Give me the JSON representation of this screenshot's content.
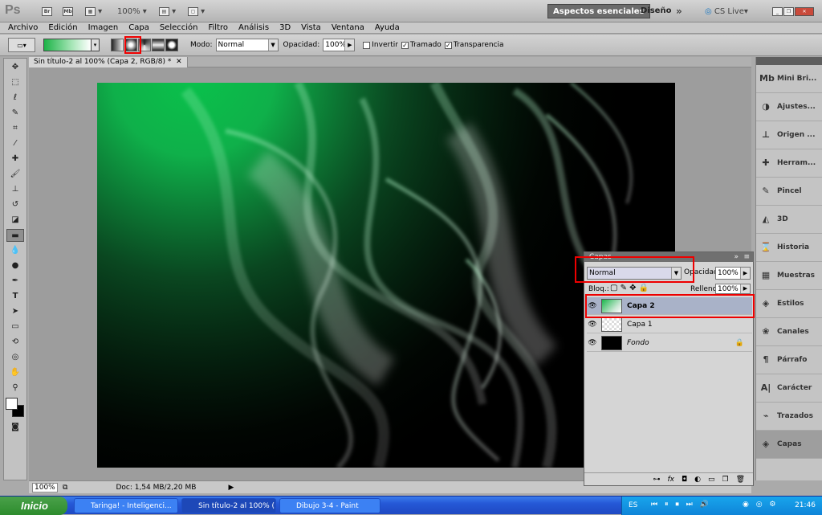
{
  "app": {
    "logo": "Ps",
    "zoom": "100%",
    "workspace_active": "Aspectos esenciales",
    "workspace_other": "Diseño",
    "cs_live": "CS Live"
  },
  "menu": [
    "Archivo",
    "Edición",
    "Imagen",
    "Capa",
    "Selección",
    "Filtro",
    "Análisis",
    "3D",
    "Vista",
    "Ventana",
    "Ayuda"
  ],
  "options": {
    "mode_label": "Modo:",
    "mode_value": "Normal",
    "opacity_label": "Opacidad:",
    "opacity_value": "100%",
    "invert_label": "Invertir",
    "dither_label": "Tramado",
    "transparency_label": "Transparencia"
  },
  "document": {
    "tab_title": "Sin título-2 al 100% (Capa 2, RGB/8) *"
  },
  "status": {
    "zoom": "100%",
    "doc": "Doc: 1,54 MB/2,20 MB"
  },
  "right_dock": [
    "Mini Bri...",
    "Ajustes...",
    "Origen ...",
    "Herram...",
    "Pincel",
    "3D",
    "Historia",
    "Muestras",
    "Estilos",
    "Canales",
    "Párrafo",
    "Carácter",
    "Trazados",
    "Capas"
  ],
  "layers_panel": {
    "title": "Capas",
    "blend_mode": "Normal",
    "opacity_label": "Opacidad:",
    "opacity_value": "100%",
    "lock_label": "Bloq.:",
    "fill_label": "Relleno:",
    "fill_value": "100%",
    "layers": [
      {
        "name": "Capa 2"
      },
      {
        "name": "Capa 1"
      },
      {
        "name": "Fondo"
      }
    ]
  },
  "taskbar": {
    "start": "Inicio",
    "tasks": [
      "Taringa! - Inteligenci...",
      "Sin título-2 al 100% (...",
      "Dibujo 3-4 - Paint"
    ],
    "lang": "ES",
    "clock": "21:46"
  }
}
